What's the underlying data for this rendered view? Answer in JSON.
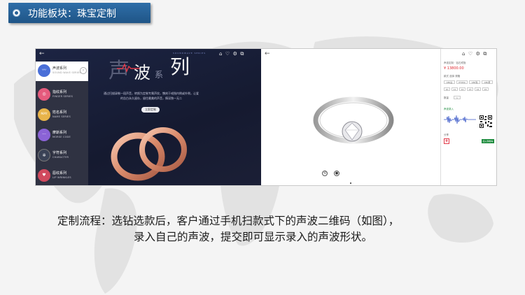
{
  "banner": {
    "title": "功能板块：珠宝定制"
  },
  "screenshot": {
    "left": {
      "back_icon": "arrow-left-icon",
      "hero": {
        "char1": "声",
        "char2": "波",
        "char3": "系",
        "char4": "列",
        "tag": "SOUNDWAVE SERIES",
        "description": "通过扫描录制一段声音，转换为定制专属声纹，镌刻于戒指内侧或外侧，让爱的告白永久留存，留住最美的声音，情深独一无二",
        "button": "立即定制"
      },
      "top_icons": [
        "⌂",
        "♡",
        "⚙",
        "⧉"
      ],
      "sidebar": [
        {
          "title": "声波系列",
          "subtitle": "SOUND WAVE SERIES",
          "icon": "soundwave-icon",
          "color": "#4a6fd8",
          "glyph": "〰",
          "active": true
        },
        {
          "title": "指纹系列",
          "subtitle": "FINGER SERIES",
          "icon": "fingerprint-icon",
          "color": "#e55b7d",
          "glyph": "◎",
          "active": false
        },
        {
          "title": "姓名系列",
          "subtitle": "NAME SERIES",
          "icon": "name-icon",
          "color": "#e8b44a",
          "glyph": "MAY",
          "active": false
        },
        {
          "title": "摩斯系列",
          "subtitle": "MORSE CODE",
          "icon": "morse-icon",
          "color": "#8b63d6",
          "glyph": "···",
          "active": false
        },
        {
          "title": "字符系列",
          "subtitle": "CHARACTER",
          "icon": "character-icon",
          "color": "#3a4256",
          "glyph": "✲",
          "active": false
        },
        {
          "title": "唇纹系列",
          "subtitle": "LIP WRINKLES",
          "icon": "lips-icon",
          "color": "#d14a5e",
          "glyph": "♥",
          "active": false
        }
      ]
    },
    "right": {
      "back_icon": "arrow-left-icon",
      "top_icons": [
        "⌂",
        "♡",
        "⚙",
        "⧉"
      ],
      "product_title": "声波定制 · 钻石戒指",
      "price": "¥ 13800.00",
      "spec_label": "款式 选择 规格",
      "options": [
        "18K白",
        "PT950",
        "18K玫",
        "18K黄"
      ],
      "sizes": [
        "10",
        "11",
        "12",
        "13",
        "14",
        "15"
      ],
      "wave_label": "声波录入",
      "qty_label": "数量",
      "qty_value": "1",
      "share_label": "分享",
      "submit_button": "加入购物车",
      "ctrl_icons": [
        "rotate-icon",
        "camera-icon"
      ]
    }
  },
  "caption": {
    "line1": "定制流程：选钻选款后，客户通过手机扫款式下的声波二维码（如图），",
    "line2": "录入自己的声波，提交即可显示录入的声波形状。"
  }
}
